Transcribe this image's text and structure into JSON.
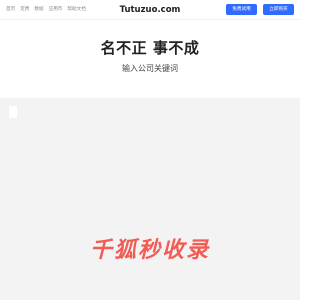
{
  "topnav": {
    "links": [
      "首页",
      "定费",
      "数据",
      "应用市",
      "帮助文档"
    ],
    "brand": "Tutuzuo.com",
    "trial_label": "免费试用",
    "buy_label": "立即购买"
  },
  "hero": {
    "title": "名不正 事不成",
    "subtitle": "输入公司关键词"
  },
  "watermark": {
    "text": "千狐秒收录"
  },
  "colors": {
    "accent": "#2f6bff",
    "content_bg": "#f3f3f3",
    "watermark": "#f25c54"
  }
}
